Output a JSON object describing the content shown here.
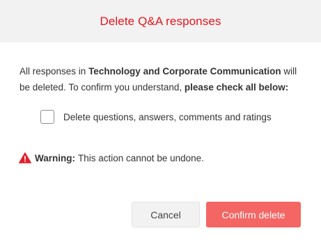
{
  "dialog": {
    "title": "Delete Q&A responses",
    "body": {
      "part1": "All responses in ",
      "target_name": "Technology and Corporate Communication",
      "part2": " will be deleted. To confirm you understand, ",
      "emphasis": "please check all below:"
    },
    "checkbox": {
      "label": "Delete questions, answers, comments and ratings",
      "checked": false
    },
    "warning": {
      "icon": "warning-triangle-icon",
      "label": "Warning:",
      "text": "This action cannot be undone."
    },
    "buttons": {
      "cancel_label": "Cancel",
      "confirm_label": "Confirm delete"
    },
    "colors": {
      "title": "#e8131c",
      "header_bg": "#f2f2f2",
      "confirm_bg": "#f46664",
      "warning_icon": "#e0202b"
    }
  }
}
